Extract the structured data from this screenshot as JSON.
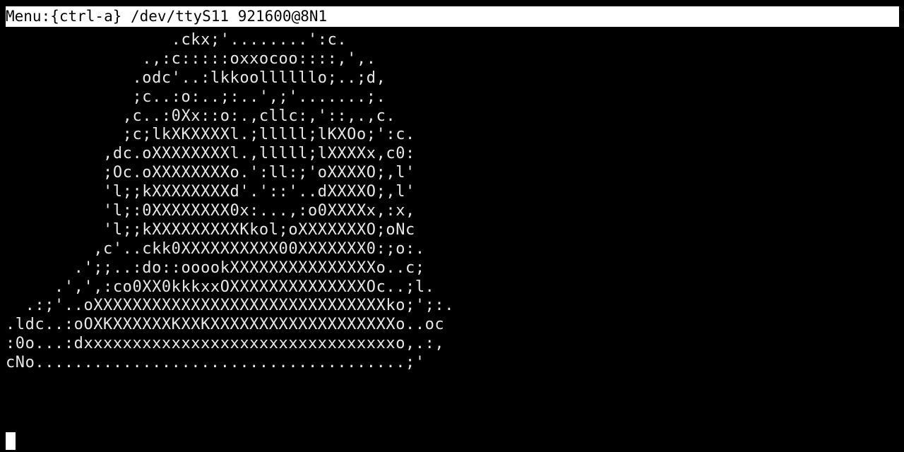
{
  "status_bar": {
    "text": "Menu:{ctrl-a} /dev/ttyS11 921600@8N1"
  },
  "terminal": {
    "lines": [
      "                 .ckx;'........':c.",
      "              .,:c:::::oxxocoo::::,',.",
      "             .odc'..:lkkoollllllo;..;d,",
      "             ;c..:o:..;:..',;'.......;.",
      "            ,c..:0Xx::o:.,cllc:,'::,.,c.",
      "            ;c;lkXKXXXXl.;lllll;lKXOo;':c.",
      "          ,dc.oXXXXXXXXl.,lllll;lXXXXx,c0:",
      "          ;Oc.oXXXXXXXXo.':ll:;'oXXXXO;,l'",
      "          'l;;kXXXXXXXXd'.'::'..dXXXXO;,l'",
      "          'l;:0XXXXXXXX0x:...,:o0XXXXx,:x,",
      "          'l;;kXXXXXXXXXKkol;oXXXXXXXO;oNc",
      "         ,c'..ckk0XXXXXXXXXX00XXXXXXX0:;o:.",
      "       .';;..:do::ooookXXXXXXXXXXXXXXXo..c;",
      "     .',',:co0XX0kkkxxOXXXXXXXXXXXXXXOc..;l.",
      "  .:;'..oXXXXXXXXXXXXXXXXXXXXXXXXXXXXXXko;';:.",
      ".ldc..:oOXKXXXXXXKXXKXXXXXXXXXXXXXXXXXXXo..oc",
      ":0o...:dxxxxxxxxxxxxxxxxxxxxxxxxxxxxxxxxo,.:,",
      "cNo......................................;'"
    ]
  },
  "colors": {
    "background": "#000000",
    "foreground": "#e8e8e8",
    "status_bar_bg": "#ffffff",
    "status_bar_fg": "#000000",
    "cursor": "#ffffff"
  }
}
